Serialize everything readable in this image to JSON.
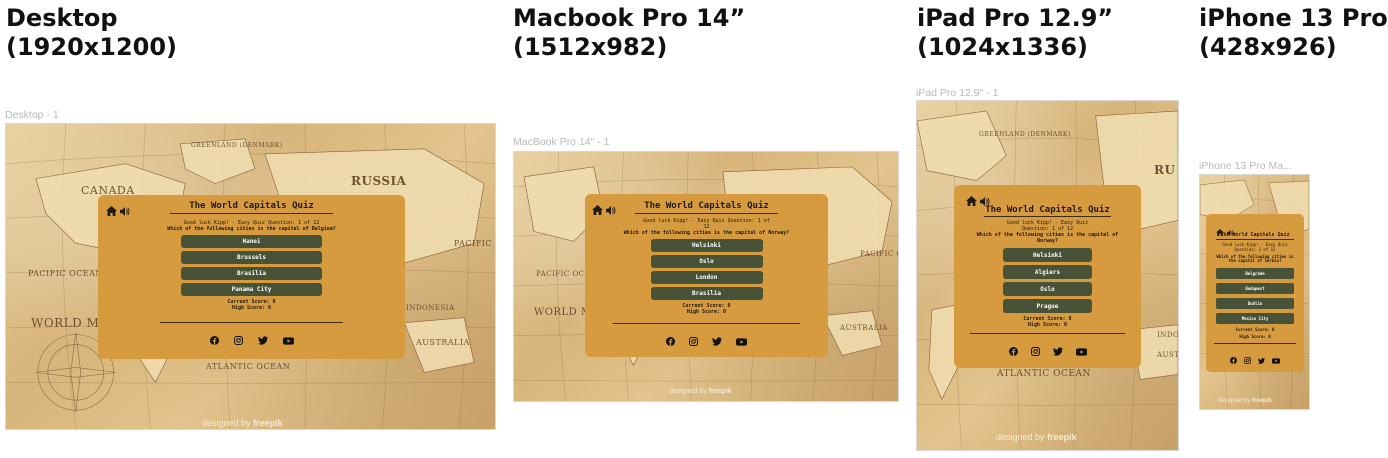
{
  "devices": [
    {
      "heading": [
        "Desktop",
        "(1920x1200)"
      ],
      "frame_label": "Desktop - 1",
      "quiz": {
        "title": "The World Capitals Quiz",
        "progress_lines": [
          "Good luck Kipp! - Easy Quiz Question: 1 of 12"
        ],
        "question_lines": [
          "Which of the following cities is the capital of Belgium?"
        ],
        "answers": [
          "Hanoi",
          "Brussels",
          "Brasilia",
          "Panama City"
        ],
        "current_score": "Current Score: 0",
        "high_score": "High Score: 0"
      },
      "map_labels": [
        "CANADA",
        "RUSSIA",
        "PACIFIC OCEAN",
        "PACIFIC OCEAN",
        "WORLD MA",
        "AUSTRALIA",
        "INDONESIA",
        "ATLANTIC OCEAN",
        "GREENLAND (DENMARK)"
      ],
      "credit": {
        "prefix": "designed by",
        "brand": "freepik"
      }
    },
    {
      "heading": [
        "Macbook Pro 14”",
        "(1512x982)"
      ],
      "frame_label": "MacBook Pro 14\" - 1",
      "quiz": {
        "title": "The World Capitals Quiz",
        "progress_lines": [
          "Good luck Kipp! - Easy Quiz Question: 1 of",
          "12"
        ],
        "question_lines": [
          "Which of the following cities is the capital of Norway?"
        ],
        "answers": [
          "Helsinki",
          "Oslo",
          "London",
          "Brasilia"
        ],
        "current_score": "Current Score: 0",
        "high_score": "High Score: 0"
      },
      "map_labels": [
        "PACIFIC OCEAN",
        "WORLD MA",
        "PACIFIC OCEAN",
        "AUSTRALIA"
      ],
      "credit": {
        "prefix": "designed by",
        "brand": "freepik"
      }
    },
    {
      "heading": [
        "iPad Pro 12.9”",
        "(1024x1336)"
      ],
      "frame_label": "iPad Pro 12.9\" - 1",
      "quiz": {
        "title": "The World Capitals Quiz",
        "progress_lines": [
          "Good luck Kipp! - Easy Quiz",
          "Question: 1 of 12"
        ],
        "question_lines": [
          "Which of the following cities is the capital of",
          "Norway?"
        ],
        "answers": [
          "Helsinki",
          "Algiers",
          "Oslo",
          "Prague"
        ],
        "current_score": "Current Score: 0",
        "high_score": "High Score: 0"
      },
      "map_labels": [
        "GREENLAND (DENMARK)",
        "RU",
        "ATLANTIC OCEAN",
        "INDO",
        "AUST"
      ],
      "credit": {
        "prefix": "designed by",
        "brand": "freepik"
      }
    },
    {
      "heading": [
        "iPhone 13 Pro",
        "(428x926)"
      ],
      "frame_label": "iPhone 13 Pro Ma...",
      "quiz": {
        "title": "The World Capitals Quiz",
        "progress_lines": [
          "Good luck Kipp! - Easy Quiz",
          "Question: 1 of 12"
        ],
        "question_lines": [
          "Which of the following cities is",
          "the capital of Serbia?"
        ],
        "answers": [
          "Belgrade",
          "Budapest",
          "Dublin",
          "Mexico City"
        ],
        "current_score": "Current Score: 0",
        "high_score": "High Score: 0"
      },
      "map_labels": [],
      "credit": {
        "prefix": "designed by",
        "brand": "freepik"
      }
    }
  ],
  "icons": [
    "home-icon",
    "volume-icon",
    "facebook-icon",
    "instagram-icon",
    "twitter-icon",
    "youtube-icon"
  ],
  "colors": {
    "panel": "#d69a3f",
    "answer_button": "#475237",
    "map_base": "#dcbf88",
    "frame_label": "#b9b9b9"
  }
}
